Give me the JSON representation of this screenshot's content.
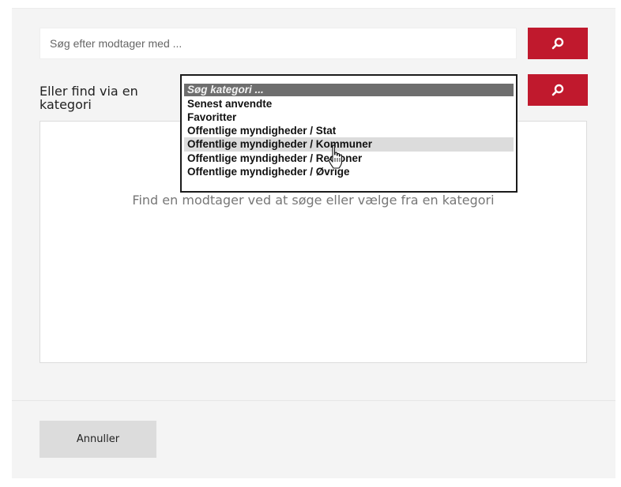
{
  "search": {
    "placeholder": "Søg efter modtager med ...",
    "icon": "search-icon"
  },
  "category": {
    "label": "Eller find via en kategori",
    "dropdown": {
      "placeholder": "Søg kategori ...",
      "options": [
        "Senest anvendte",
        "Favoritter",
        "Offentlige myndigheder / Stat",
        "Offentlige myndigheder / Kommuner",
        "Offentlige myndigheder / Regioner",
        "Offentlige myndigheder / Øvrige"
      ],
      "hovered_index": 3
    }
  },
  "results": {
    "empty_message": "Find en modtager ved at søge eller vælge fra en kategori"
  },
  "footer": {
    "cancel_label": "Annuller"
  },
  "colors": {
    "accent": "#c0192d",
    "background": "#f4f4f4"
  }
}
